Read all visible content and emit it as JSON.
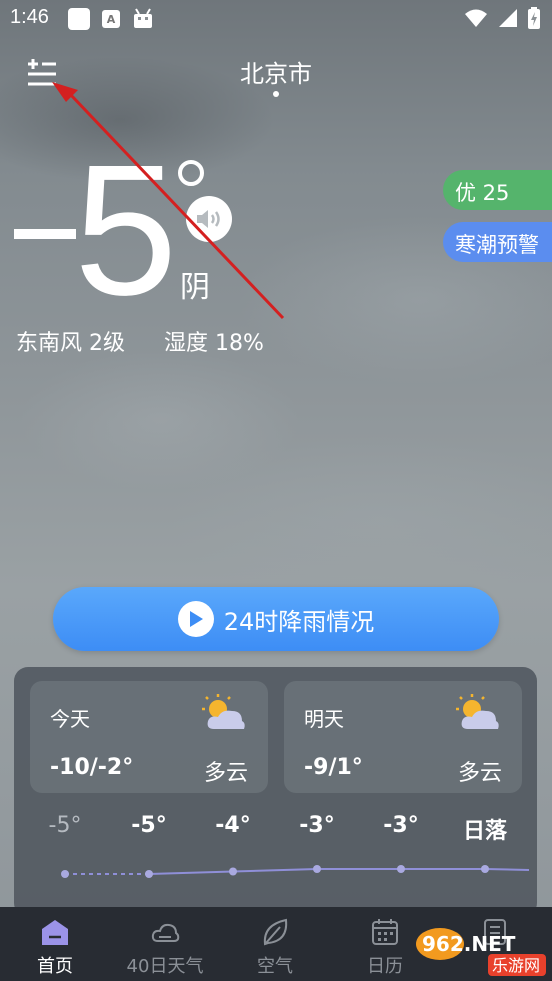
{
  "status_bar": {
    "time": "1:46",
    "left_icons": [
      "notification-square-icon",
      "app-a-icon",
      "android-icon"
    ],
    "right_icons": [
      "wifi-icon",
      "signal-icon",
      "battery-charging-icon"
    ],
    "a_glyph": "A"
  },
  "header": {
    "menu_icon": "city-menu-icon",
    "city": "北京市"
  },
  "current": {
    "minus": "−",
    "temperature": "5",
    "condition": "阴",
    "wind": "东南风 2级",
    "humidity": "湿度 18%",
    "speaker_icon": "speaker-icon"
  },
  "badges": {
    "aqi": "优 25",
    "alert": "寒潮预警",
    "aqi_color": "#55b46c",
    "alert_color": "#5b8def"
  },
  "rain_button": {
    "label": "24时降雨情况",
    "icon": "play-icon"
  },
  "forecast": {
    "today": {
      "name": "今天",
      "range": "-10/-2°",
      "condition": "多云",
      "icon": "partly-cloudy-icon"
    },
    "tomorrow": {
      "name": "明天",
      "range": "-9/1°",
      "condition": "多云",
      "icon": "partly-cloudy-icon"
    },
    "hours": [
      {
        "label": "-5°",
        "value": -5,
        "dim": true
      },
      {
        "label": "-5°",
        "value": -5,
        "dim": false
      },
      {
        "label": "-4°",
        "value": -4,
        "dim": false
      },
      {
        "label": "-3°",
        "value": -3,
        "dim": false
      },
      {
        "label": "-3°",
        "value": -3,
        "dim": false
      },
      {
        "label": "日落",
        "value": -3,
        "dim": false
      }
    ]
  },
  "nav": {
    "items": [
      {
        "label": "首页",
        "icon": "home-icon",
        "active": true
      },
      {
        "label": "40日天气",
        "icon": "cloud-icon",
        "active": false
      },
      {
        "label": "空气",
        "icon": "leaf-icon",
        "active": false
      },
      {
        "label": "日历",
        "icon": "calendar-icon",
        "active": false
      },
      {
        "label": "",
        "icon": "document-icon",
        "active": false
      }
    ]
  },
  "watermark": {
    "brand": "962.NET",
    "sub": "乐游网"
  },
  "colors": {
    "accent_blue": "#3d8df5",
    "nav_bg": "#282c33",
    "annotation_red": "#d42020"
  }
}
